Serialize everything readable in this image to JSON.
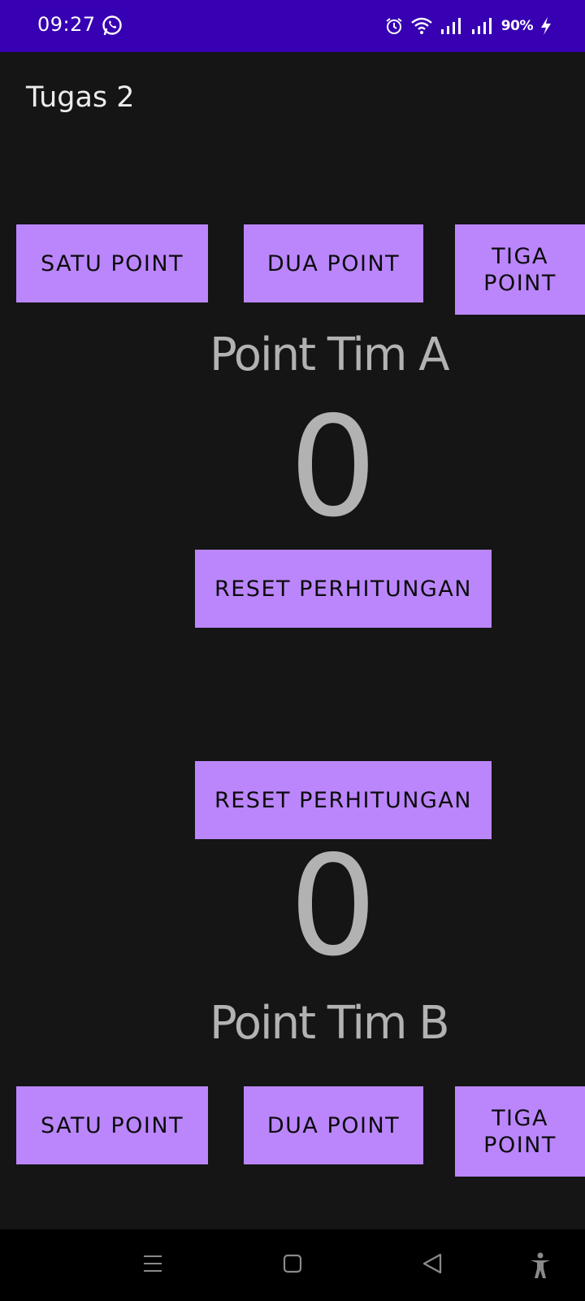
{
  "status_bar": {
    "time": "09:27",
    "battery": "90%",
    "icons": [
      "whatsapp-icon",
      "alarm-icon",
      "wifi-icon",
      "signal-icon",
      "signal-icon",
      "charging-icon"
    ]
  },
  "app": {
    "title": "Tugas 2"
  },
  "team_a": {
    "one_point_label": "SATU POINT",
    "two_point_label": "DUA POINT",
    "three_point_label": "TIGA\nPOINT",
    "team_label": "Point Tim A",
    "score": "0",
    "reset_label": "RESET PERHITUNGAN"
  },
  "team_b": {
    "reset_label": "RESET PERHITUNGAN",
    "score": "0",
    "team_label": "Point Tim B",
    "one_point_label": "SATU POINT",
    "two_point_label": "DUA POINT",
    "three_point_label": "TIGA\nPOINT"
  },
  "colors": {
    "status_bar": "#3700B3",
    "background": "#151515",
    "button": "#BB86FC",
    "score_text": "#b2b2b2"
  },
  "nav_bar": {
    "icons": [
      "menu-icon",
      "home-icon",
      "back-icon",
      "accessibility-icon"
    ]
  }
}
